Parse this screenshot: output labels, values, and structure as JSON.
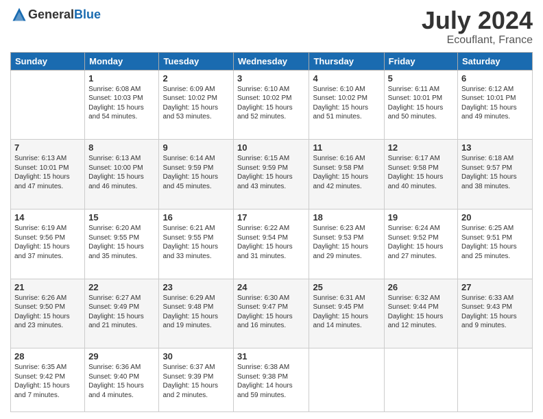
{
  "header": {
    "logo": {
      "general": "General",
      "blue": "Blue"
    },
    "month": "July 2024",
    "location": "Ecouflant, France"
  },
  "weekdays": [
    "Sunday",
    "Monday",
    "Tuesday",
    "Wednesday",
    "Thursday",
    "Friday",
    "Saturday"
  ],
  "weeks": [
    [
      {
        "day": "",
        "info": ""
      },
      {
        "day": "1",
        "info": "Sunrise: 6:08 AM\nSunset: 10:03 PM\nDaylight: 15 hours\nand 54 minutes."
      },
      {
        "day": "2",
        "info": "Sunrise: 6:09 AM\nSunset: 10:02 PM\nDaylight: 15 hours\nand 53 minutes."
      },
      {
        "day": "3",
        "info": "Sunrise: 6:10 AM\nSunset: 10:02 PM\nDaylight: 15 hours\nand 52 minutes."
      },
      {
        "day": "4",
        "info": "Sunrise: 6:10 AM\nSunset: 10:02 PM\nDaylight: 15 hours\nand 51 minutes."
      },
      {
        "day": "5",
        "info": "Sunrise: 6:11 AM\nSunset: 10:01 PM\nDaylight: 15 hours\nand 50 minutes."
      },
      {
        "day": "6",
        "info": "Sunrise: 6:12 AM\nSunset: 10:01 PM\nDaylight: 15 hours\nand 49 minutes."
      }
    ],
    [
      {
        "day": "7",
        "info": "Sunrise: 6:13 AM\nSunset: 10:01 PM\nDaylight: 15 hours\nand 47 minutes."
      },
      {
        "day": "8",
        "info": "Sunrise: 6:13 AM\nSunset: 10:00 PM\nDaylight: 15 hours\nand 46 minutes."
      },
      {
        "day": "9",
        "info": "Sunrise: 6:14 AM\nSunset: 9:59 PM\nDaylight: 15 hours\nand 45 minutes."
      },
      {
        "day": "10",
        "info": "Sunrise: 6:15 AM\nSunset: 9:59 PM\nDaylight: 15 hours\nand 43 minutes."
      },
      {
        "day": "11",
        "info": "Sunrise: 6:16 AM\nSunset: 9:58 PM\nDaylight: 15 hours\nand 42 minutes."
      },
      {
        "day": "12",
        "info": "Sunrise: 6:17 AM\nSunset: 9:58 PM\nDaylight: 15 hours\nand 40 minutes."
      },
      {
        "day": "13",
        "info": "Sunrise: 6:18 AM\nSunset: 9:57 PM\nDaylight: 15 hours\nand 38 minutes."
      }
    ],
    [
      {
        "day": "14",
        "info": "Sunrise: 6:19 AM\nSunset: 9:56 PM\nDaylight: 15 hours\nand 37 minutes."
      },
      {
        "day": "15",
        "info": "Sunrise: 6:20 AM\nSunset: 9:55 PM\nDaylight: 15 hours\nand 35 minutes."
      },
      {
        "day": "16",
        "info": "Sunrise: 6:21 AM\nSunset: 9:55 PM\nDaylight: 15 hours\nand 33 minutes."
      },
      {
        "day": "17",
        "info": "Sunrise: 6:22 AM\nSunset: 9:54 PM\nDaylight: 15 hours\nand 31 minutes."
      },
      {
        "day": "18",
        "info": "Sunrise: 6:23 AM\nSunset: 9:53 PM\nDaylight: 15 hours\nand 29 minutes."
      },
      {
        "day": "19",
        "info": "Sunrise: 6:24 AM\nSunset: 9:52 PM\nDaylight: 15 hours\nand 27 minutes."
      },
      {
        "day": "20",
        "info": "Sunrise: 6:25 AM\nSunset: 9:51 PM\nDaylight: 15 hours\nand 25 minutes."
      }
    ],
    [
      {
        "day": "21",
        "info": "Sunrise: 6:26 AM\nSunset: 9:50 PM\nDaylight: 15 hours\nand 23 minutes."
      },
      {
        "day": "22",
        "info": "Sunrise: 6:27 AM\nSunset: 9:49 PM\nDaylight: 15 hours\nand 21 minutes."
      },
      {
        "day": "23",
        "info": "Sunrise: 6:29 AM\nSunset: 9:48 PM\nDaylight: 15 hours\nand 19 minutes."
      },
      {
        "day": "24",
        "info": "Sunrise: 6:30 AM\nSunset: 9:47 PM\nDaylight: 15 hours\nand 16 minutes."
      },
      {
        "day": "25",
        "info": "Sunrise: 6:31 AM\nSunset: 9:45 PM\nDaylight: 15 hours\nand 14 minutes."
      },
      {
        "day": "26",
        "info": "Sunrise: 6:32 AM\nSunset: 9:44 PM\nDaylight: 15 hours\nand 12 minutes."
      },
      {
        "day": "27",
        "info": "Sunrise: 6:33 AM\nSunset: 9:43 PM\nDaylight: 15 hours\nand 9 minutes."
      }
    ],
    [
      {
        "day": "28",
        "info": "Sunrise: 6:35 AM\nSunset: 9:42 PM\nDaylight: 15 hours\nand 7 minutes."
      },
      {
        "day": "29",
        "info": "Sunrise: 6:36 AM\nSunset: 9:40 PM\nDaylight: 15 hours\nand 4 minutes."
      },
      {
        "day": "30",
        "info": "Sunrise: 6:37 AM\nSunset: 9:39 PM\nDaylight: 15 hours\nand 2 minutes."
      },
      {
        "day": "31",
        "info": "Sunrise: 6:38 AM\nSunset: 9:38 PM\nDaylight: 14 hours\nand 59 minutes."
      },
      {
        "day": "",
        "info": ""
      },
      {
        "day": "",
        "info": ""
      },
      {
        "day": "",
        "info": ""
      }
    ]
  ]
}
